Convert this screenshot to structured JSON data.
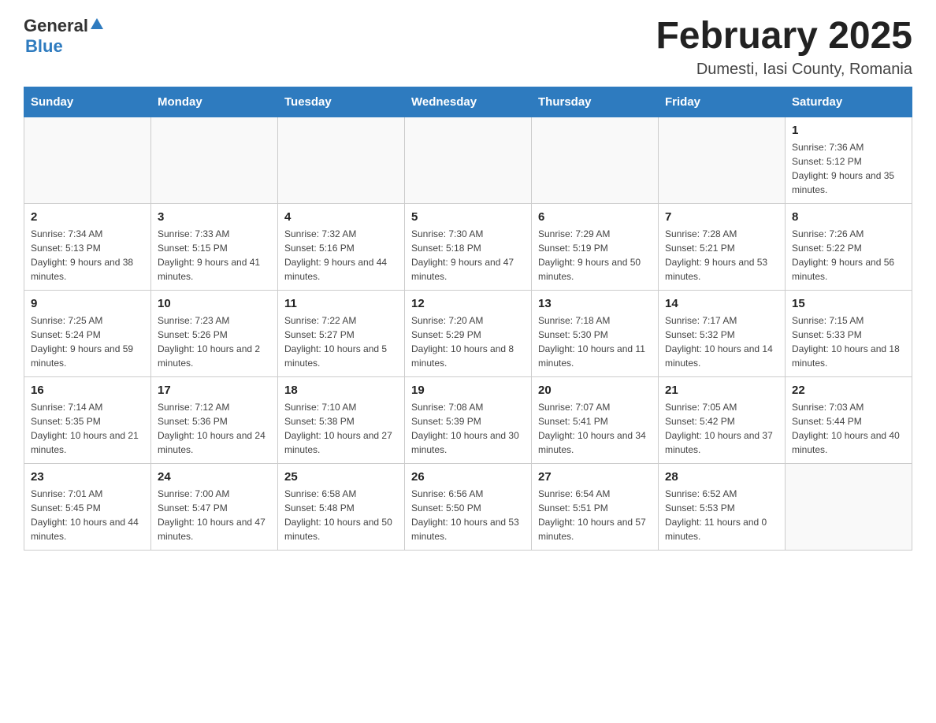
{
  "header": {
    "logo_general": "General",
    "logo_blue": "Blue",
    "title": "February 2025",
    "subtitle": "Dumesti, Iasi County, Romania"
  },
  "days_of_week": [
    "Sunday",
    "Monday",
    "Tuesday",
    "Wednesday",
    "Thursday",
    "Friday",
    "Saturday"
  ],
  "weeks": [
    [
      {
        "day": "",
        "info": ""
      },
      {
        "day": "",
        "info": ""
      },
      {
        "day": "",
        "info": ""
      },
      {
        "day": "",
        "info": ""
      },
      {
        "day": "",
        "info": ""
      },
      {
        "day": "",
        "info": ""
      },
      {
        "day": "1",
        "info": "Sunrise: 7:36 AM\nSunset: 5:12 PM\nDaylight: 9 hours and 35 minutes."
      }
    ],
    [
      {
        "day": "2",
        "info": "Sunrise: 7:34 AM\nSunset: 5:13 PM\nDaylight: 9 hours and 38 minutes."
      },
      {
        "day": "3",
        "info": "Sunrise: 7:33 AM\nSunset: 5:15 PM\nDaylight: 9 hours and 41 minutes."
      },
      {
        "day": "4",
        "info": "Sunrise: 7:32 AM\nSunset: 5:16 PM\nDaylight: 9 hours and 44 minutes."
      },
      {
        "day": "5",
        "info": "Sunrise: 7:30 AM\nSunset: 5:18 PM\nDaylight: 9 hours and 47 minutes."
      },
      {
        "day": "6",
        "info": "Sunrise: 7:29 AM\nSunset: 5:19 PM\nDaylight: 9 hours and 50 minutes."
      },
      {
        "day": "7",
        "info": "Sunrise: 7:28 AM\nSunset: 5:21 PM\nDaylight: 9 hours and 53 minutes."
      },
      {
        "day": "8",
        "info": "Sunrise: 7:26 AM\nSunset: 5:22 PM\nDaylight: 9 hours and 56 minutes."
      }
    ],
    [
      {
        "day": "9",
        "info": "Sunrise: 7:25 AM\nSunset: 5:24 PM\nDaylight: 9 hours and 59 minutes."
      },
      {
        "day": "10",
        "info": "Sunrise: 7:23 AM\nSunset: 5:26 PM\nDaylight: 10 hours and 2 minutes."
      },
      {
        "day": "11",
        "info": "Sunrise: 7:22 AM\nSunset: 5:27 PM\nDaylight: 10 hours and 5 minutes."
      },
      {
        "day": "12",
        "info": "Sunrise: 7:20 AM\nSunset: 5:29 PM\nDaylight: 10 hours and 8 minutes."
      },
      {
        "day": "13",
        "info": "Sunrise: 7:18 AM\nSunset: 5:30 PM\nDaylight: 10 hours and 11 minutes."
      },
      {
        "day": "14",
        "info": "Sunrise: 7:17 AM\nSunset: 5:32 PM\nDaylight: 10 hours and 14 minutes."
      },
      {
        "day": "15",
        "info": "Sunrise: 7:15 AM\nSunset: 5:33 PM\nDaylight: 10 hours and 18 minutes."
      }
    ],
    [
      {
        "day": "16",
        "info": "Sunrise: 7:14 AM\nSunset: 5:35 PM\nDaylight: 10 hours and 21 minutes."
      },
      {
        "day": "17",
        "info": "Sunrise: 7:12 AM\nSunset: 5:36 PM\nDaylight: 10 hours and 24 minutes."
      },
      {
        "day": "18",
        "info": "Sunrise: 7:10 AM\nSunset: 5:38 PM\nDaylight: 10 hours and 27 minutes."
      },
      {
        "day": "19",
        "info": "Sunrise: 7:08 AM\nSunset: 5:39 PM\nDaylight: 10 hours and 30 minutes."
      },
      {
        "day": "20",
        "info": "Sunrise: 7:07 AM\nSunset: 5:41 PM\nDaylight: 10 hours and 34 minutes."
      },
      {
        "day": "21",
        "info": "Sunrise: 7:05 AM\nSunset: 5:42 PM\nDaylight: 10 hours and 37 minutes."
      },
      {
        "day": "22",
        "info": "Sunrise: 7:03 AM\nSunset: 5:44 PM\nDaylight: 10 hours and 40 minutes."
      }
    ],
    [
      {
        "day": "23",
        "info": "Sunrise: 7:01 AM\nSunset: 5:45 PM\nDaylight: 10 hours and 44 minutes."
      },
      {
        "day": "24",
        "info": "Sunrise: 7:00 AM\nSunset: 5:47 PM\nDaylight: 10 hours and 47 minutes."
      },
      {
        "day": "25",
        "info": "Sunrise: 6:58 AM\nSunset: 5:48 PM\nDaylight: 10 hours and 50 minutes."
      },
      {
        "day": "26",
        "info": "Sunrise: 6:56 AM\nSunset: 5:50 PM\nDaylight: 10 hours and 53 minutes."
      },
      {
        "day": "27",
        "info": "Sunrise: 6:54 AM\nSunset: 5:51 PM\nDaylight: 10 hours and 57 minutes."
      },
      {
        "day": "28",
        "info": "Sunrise: 6:52 AM\nSunset: 5:53 PM\nDaylight: 11 hours and 0 minutes."
      },
      {
        "day": "",
        "info": ""
      }
    ]
  ]
}
